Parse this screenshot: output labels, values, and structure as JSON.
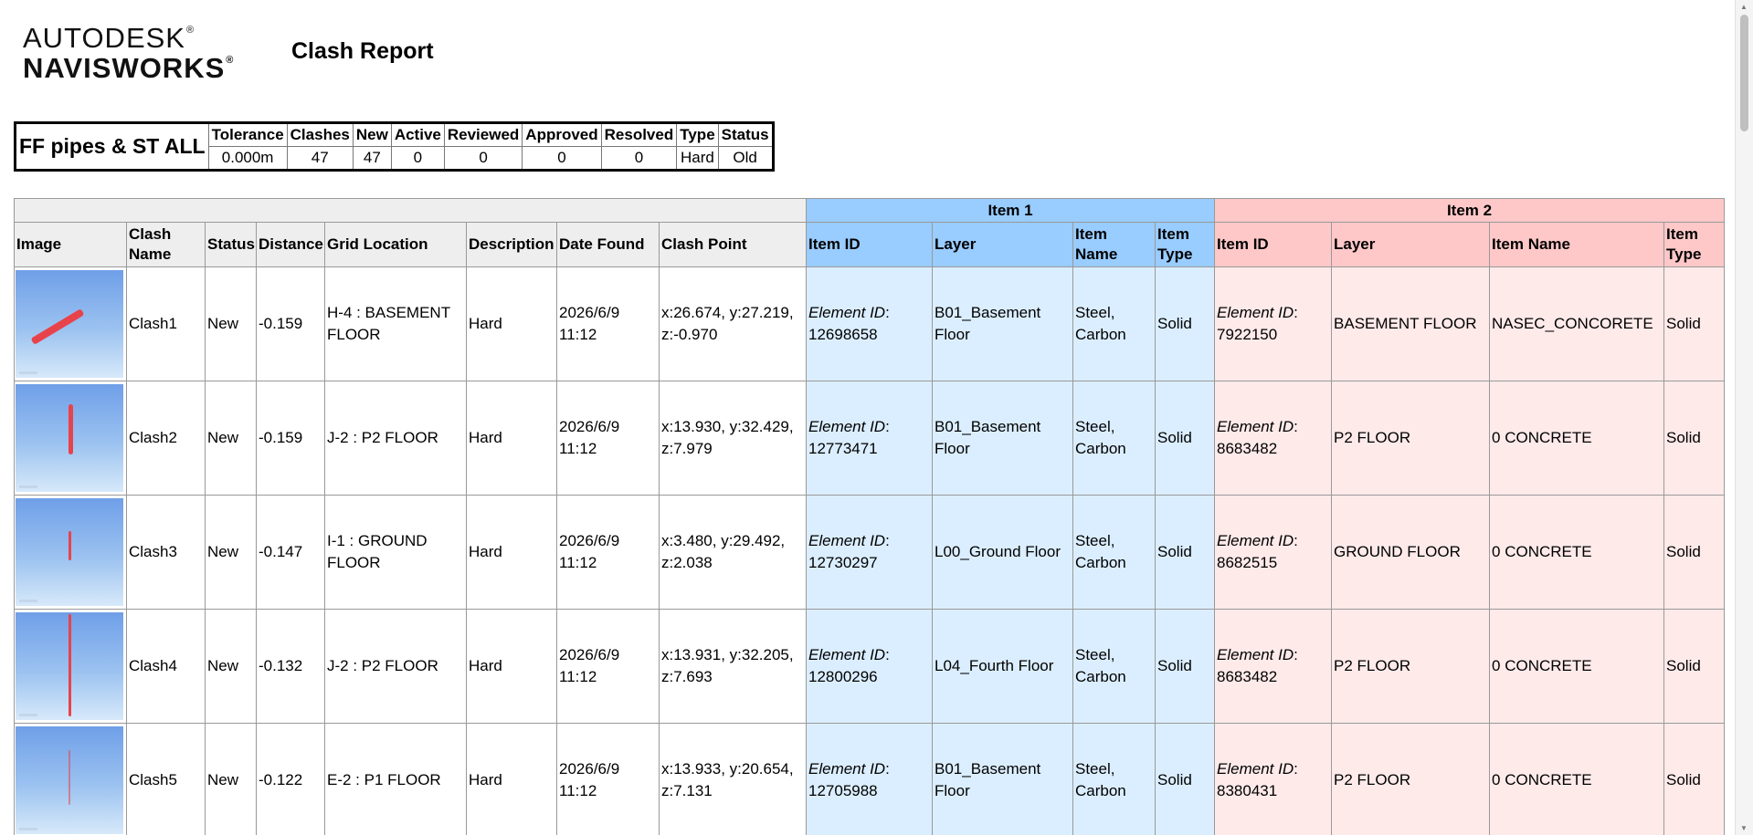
{
  "logo": {
    "line1": "AUTODESK",
    "line2": "NAVISWORKS",
    "mark": "®"
  },
  "report_title": "Clash Report",
  "summary": {
    "test_name": "FF pipes & ST ALL",
    "headers": [
      "Tolerance",
      "Clashes",
      "New",
      "Active",
      "Reviewed",
      "Approved",
      "Resolved",
      "Type",
      "Status"
    ],
    "values": [
      "0.000m",
      "47",
      "47",
      "0",
      "0",
      "0",
      "0",
      "Hard",
      "Old"
    ]
  },
  "table": {
    "group_item1": "Item 1",
    "group_item2": "Item 2",
    "headers": {
      "image": "Image",
      "clash_name": "Clash Name",
      "status": "Status",
      "distance": "Distance",
      "grid_location": "Grid Location",
      "description": "Description",
      "date_found": "Date Found",
      "clash_point": "Clash Point",
      "item1_id": "Item ID",
      "item1_layer": "Layer",
      "item1_name": "Item Name",
      "item1_type": "Item Type",
      "item2_id": "Item ID",
      "item2_layer": "Layer",
      "item2_name": "Item Name",
      "item2_type": "Item Type"
    },
    "element_id_label": "Element ID",
    "rows": [
      {
        "name": "Clash1",
        "status": "New",
        "distance": "-0.159",
        "grid": "H-4 : BASEMENT FLOOR",
        "desc": "Hard",
        "date": "2026/6/9 11:12",
        "point": "x:26.674, y:27.219, z:-0.970",
        "i1_id": "12698658",
        "i1_layer": "B01_Basement Floor",
        "i1_name": "Steel, Carbon",
        "i1_type": "Solid",
        "i2_id": "7922150",
        "i2_layer": "BASEMENT FLOOR",
        "i2_name": "NASEC_CONCORETE",
        "i2_type": "Solid"
      },
      {
        "name": "Clash2",
        "status": "New",
        "distance": "-0.159",
        "grid": "J-2 : P2 FLOOR",
        "desc": "Hard",
        "date": "2026/6/9 11:12",
        "point": "x:13.930, y:32.429, z:7.979",
        "i1_id": "12773471",
        "i1_layer": "B01_Basement Floor",
        "i1_name": "Steel, Carbon",
        "i1_type": "Solid",
        "i2_id": "8683482",
        "i2_layer": "P2 FLOOR",
        "i2_name": "0 CONCRETE",
        "i2_type": "Solid"
      },
      {
        "name": "Clash3",
        "status": "New",
        "distance": "-0.147",
        "grid": "I-1 : GROUND FLOOR",
        "desc": "Hard",
        "date": "2026/6/9 11:12",
        "point": "x:3.480, y:29.492, z:2.038",
        "i1_id": "12730297",
        "i1_layer": "L00_Ground Floor",
        "i1_name": "Steel, Carbon",
        "i1_type": "Solid",
        "i2_id": "8682515",
        "i2_layer": "GROUND FLOOR",
        "i2_name": "0 CONCRETE",
        "i2_type": "Solid"
      },
      {
        "name": "Clash4",
        "status": "New",
        "distance": "-0.132",
        "grid": "J-2 : P2 FLOOR",
        "desc": "Hard",
        "date": "2026/6/9 11:12",
        "point": "x:13.931, y:32.205, z:7.693",
        "i1_id": "12800296",
        "i1_layer": "L04_Fourth Floor",
        "i1_name": "Steel, Carbon",
        "i1_type": "Solid",
        "i2_id": "8683482",
        "i2_layer": "P2 FLOOR",
        "i2_name": "0 CONCRETE",
        "i2_type": "Solid"
      },
      {
        "name": "Clash5",
        "status": "New",
        "distance": "-0.122",
        "grid": "E-2 : P1 FLOOR",
        "desc": "Hard",
        "date": "2026/6/9 11:12",
        "point": "x:13.933, y:20.654, z:7.131",
        "i1_id": "12705988",
        "i1_layer": "B01_Basement Floor",
        "i1_name": "Steel, Carbon",
        "i1_type": "Solid",
        "i2_id": "8380431",
        "i2_layer": "P2 FLOOR",
        "i2_name": "0 CONCRETE",
        "i2_type": "Solid"
      }
    ]
  },
  "colors": {
    "item1_header": "#99ccff",
    "item1_cell": "#dbeeff",
    "item2_header": "#ffc8c8",
    "item2_cell": "#ffeaea",
    "clash_pipe": "#e8434a"
  }
}
